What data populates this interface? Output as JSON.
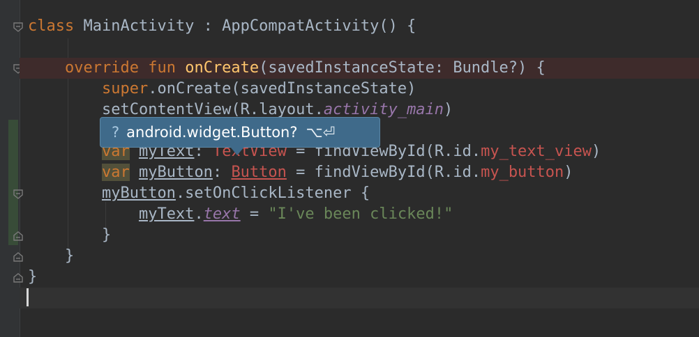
{
  "colors": {
    "background": "#2b2b2b",
    "keyword": "#cc7832",
    "function": "#ffc66d",
    "string": "#6a8759",
    "property": "#9876aa",
    "error": "#c75450",
    "popup": "#3f6a8a"
  },
  "code": {
    "line1": {
      "kw": "class",
      "rest": " MainActivity : AppCompatActivity() {"
    },
    "line3": {
      "kw1": "override",
      "kw2": "fun",
      "fn": "onCreate",
      "rest": "(savedInstanceState: Bundle?) {"
    },
    "line4": {
      "kw": "super",
      "rest": ".onCreate(savedInstanceState)"
    },
    "line5": {
      "pre": "setContentView(R.layout.",
      "prop": "activity_main",
      "post": ")"
    },
    "line7": {
      "kw": "var",
      "name": "myText",
      "colon": ": ",
      "type": "TextView",
      "mid": " = findViewById(R.id.",
      "id": "my_text_view",
      "post": ")"
    },
    "line8": {
      "kw": "var",
      "name": "myButton",
      "colon": ": ",
      "type": "Button",
      "mid": " = findViewById(R.id.",
      "id": "my_button",
      "post": ")"
    },
    "line9": {
      "name": "myButton",
      "rest": ".setOnClickListener {"
    },
    "line10": {
      "name": "myText",
      "dot": ".",
      "prop": "text",
      "eq": " = ",
      "str": "\"I've been clicked!\""
    },
    "line11": {
      "text": "}"
    },
    "line12": {
      "text": "}"
    },
    "line13": {
      "text": "}"
    }
  },
  "popup": {
    "question": "?",
    "text": "android.widget.Button?",
    "shortcut": "⌥⏎"
  }
}
